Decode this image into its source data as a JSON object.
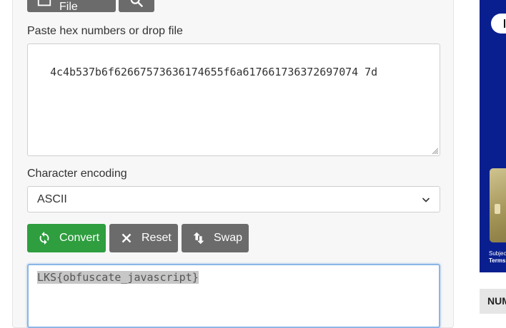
{
  "toolbar": {
    "open_file_label": "Open File"
  },
  "input": {
    "label": "Paste hex numbers or drop file",
    "value": "4c4b537b6f62667573636174655f6a617661736372697074 7d"
  },
  "encoding": {
    "label": "Character encoding",
    "selected": "ASCII"
  },
  "actions": {
    "convert_label": "Convert",
    "reset_label": "Reset",
    "swap_label": "Swap"
  },
  "output": {
    "value": "LKS{obfuscate_javascript}"
  },
  "sidebar": {
    "ad_terms": "Subject",
    "ad_terms2": "Terms",
    "tab_label": "NUM"
  },
  "colors": {
    "button_green": "#2e9e3f",
    "button_grey": "#6b6b6b",
    "ad_blue": "#0a1f8f"
  }
}
